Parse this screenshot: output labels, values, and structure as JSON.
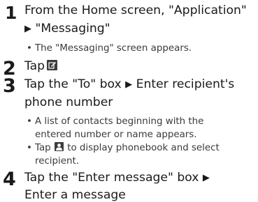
{
  "steps": [
    {
      "number": "1",
      "lines": [
        "From the Home screen, \"Application\"",
        "\"Messaging\""
      ],
      "notes": [
        "The \"Messaging\" screen appears."
      ]
    },
    {
      "number": "2",
      "lines": [
        "Tap"
      ],
      "icon": "compose-message-icon"
    },
    {
      "number": "3",
      "line1_a": "Tap the \"To\" box",
      "line1_b": "Enter recipient's",
      "line2": "phone number",
      "notes": [
        [
          "A list of contacts beginning with the",
          "entered number or name appears."
        ],
        [
          "Tap",
          "to display phonebook and select",
          "recipient."
        ]
      ],
      "icon": "phonebook-contact-icon"
    },
    {
      "number": "4",
      "line1": "Tap the \"Enter message\" box",
      "line2": "Enter a message"
    }
  ],
  "arrow": "▶",
  "bullet": "•"
}
